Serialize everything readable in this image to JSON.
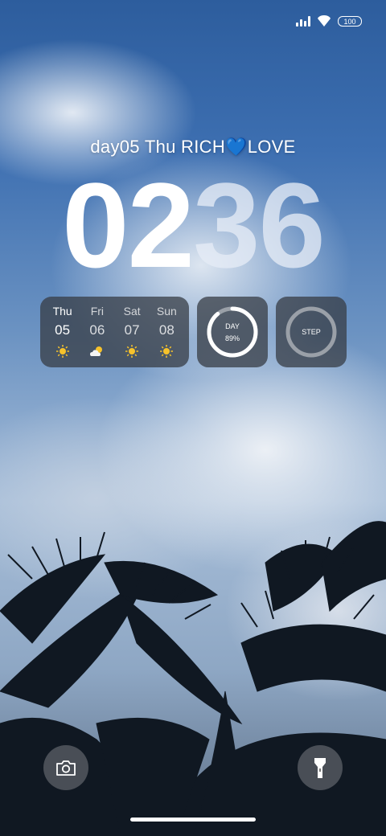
{
  "status_bar": {
    "signal_icon": "signal-bars-icon",
    "wifi_icon": "wifi-heart-icon",
    "battery": "100"
  },
  "lock_screen": {
    "date_line": "day05 Thu RICH💙LOVE",
    "time_hours": "02",
    "time_minutes": "36"
  },
  "weather_widget": {
    "days": [
      {
        "name": "Thu",
        "date": "05",
        "icon": "sunny-icon"
      },
      {
        "name": "Fri",
        "date": "06",
        "icon": "partly-cloudy-icon"
      },
      {
        "name": "Sat",
        "date": "07",
        "icon": "sunny-icon"
      },
      {
        "name": "Sun",
        "date": "08",
        "icon": "sunny-icon"
      }
    ]
  },
  "day_widget": {
    "label": "DAY",
    "percent": "89%",
    "progress": 0.89
  },
  "step_widget": {
    "label": "STEP",
    "progress": 0
  },
  "quick_actions": {
    "camera_icon": "camera-icon",
    "flashlight_icon": "flashlight-icon"
  },
  "colors": {
    "sun": "#f6c22b",
    "ring": "#ffffff",
    "ring_track": "#9aa0a8"
  }
}
